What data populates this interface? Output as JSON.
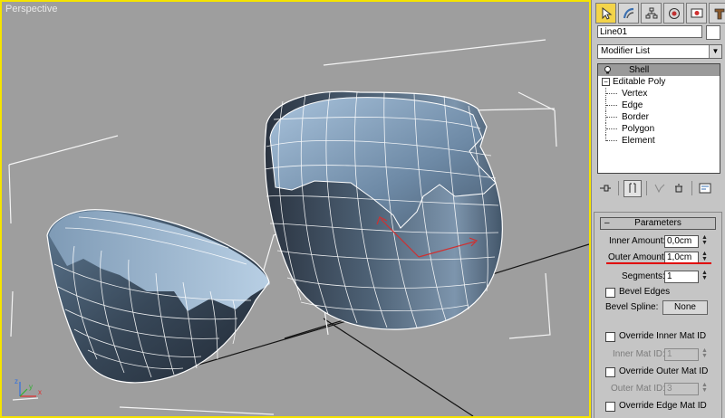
{
  "viewport": {
    "label": "Perspective",
    "border_color": "#f5e400",
    "background_color": "#9e9e9e",
    "axis_labels": [
      "z",
      "x",
      "y"
    ]
  },
  "command_panel": {
    "tabs": [
      {
        "icon": "create-icon"
      },
      {
        "icon": "modify-icon"
      },
      {
        "icon": "hierarchy-icon"
      },
      {
        "icon": "motion-icon"
      },
      {
        "icon": "display-icon"
      },
      {
        "icon": "utilities-icon"
      }
    ],
    "object_name": "Line01",
    "modifier_list": {
      "selected": "Modifier List"
    },
    "modifier_stack": [
      {
        "label": "Shell",
        "selected": true,
        "type": "modifier"
      },
      {
        "label": "Editable Poly",
        "type": "base"
      },
      {
        "label": "Vertex",
        "type": "sub"
      },
      {
        "label": "Edge",
        "type": "sub"
      },
      {
        "label": "Border",
        "type": "sub"
      },
      {
        "label": "Polygon",
        "type": "sub"
      },
      {
        "label": "Element",
        "type": "sub"
      }
    ]
  },
  "parameters": {
    "title": "Parameters",
    "collapse_symbol": "–",
    "inner_amount": {
      "label": "Inner Amount:",
      "value": "0,0cm"
    },
    "outer_amount": {
      "label": "Outer Amount:",
      "value": "1,0cm"
    },
    "segments": {
      "label": "Segments:",
      "value": "1"
    },
    "bevel_edges": {
      "label": "Bevel Edges",
      "checked": false
    },
    "bevel_spline": {
      "label": "Bevel Spline:",
      "button": "None"
    },
    "override_inner": {
      "label": "Override Inner Mat ID",
      "checked": false
    },
    "inner_mat_id": {
      "label": "Inner Mat ID:",
      "value": "1"
    },
    "override_outer": {
      "label": "Override Outer Mat ID",
      "checked": false
    },
    "outer_mat_id": {
      "label": "Outer Mat ID:",
      "value": "3"
    },
    "override_edge": {
      "label": "Override Edge Mat ID",
      "checked": false
    }
  },
  "colors": {
    "active_tab": "#f3d44a",
    "highlight_underline": "#e00000",
    "gizmo": "#d03030"
  }
}
